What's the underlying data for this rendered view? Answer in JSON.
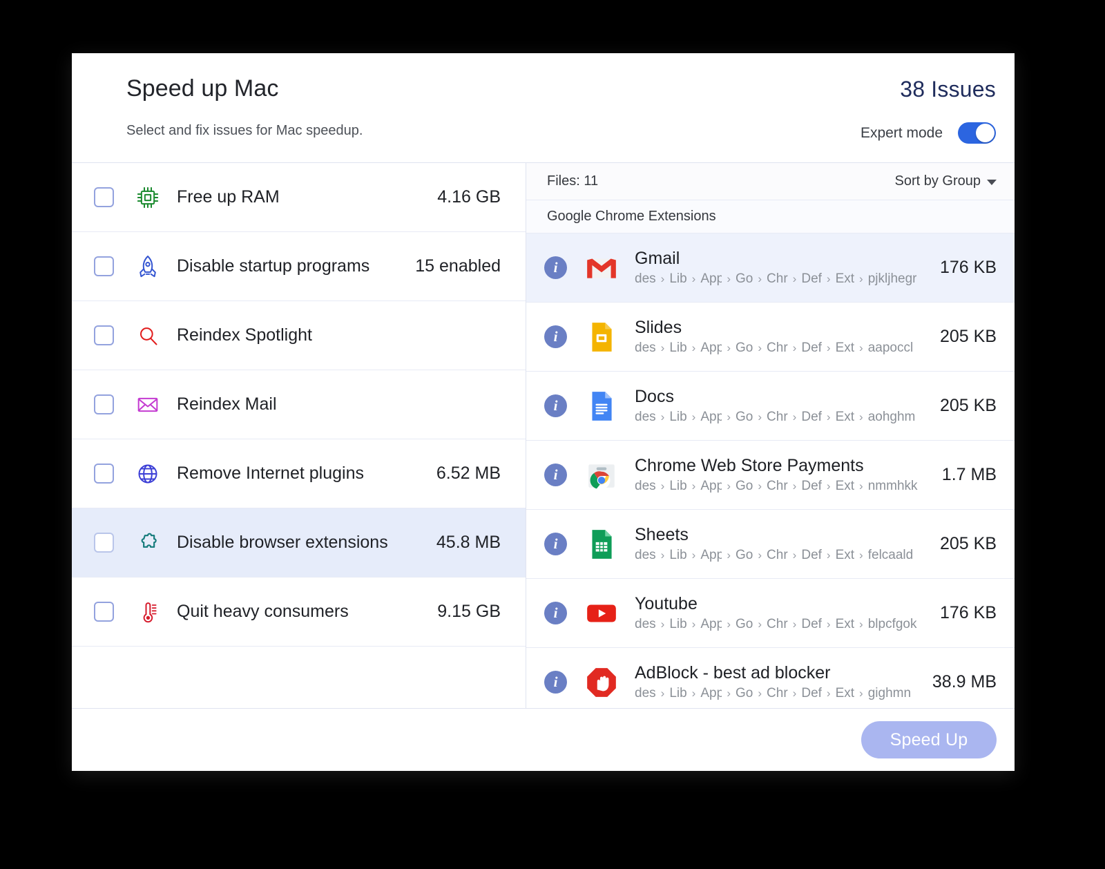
{
  "header": {
    "title": "Speed up Mac",
    "subtitle": "Select and fix issues for Mac speedup.",
    "issues": "38 Issues",
    "expert_mode_label": "Expert mode",
    "expert_mode_on": true,
    "accent_color": "#2c65e0",
    "issues_color": "#1f2c5c"
  },
  "tasks": [
    {
      "label": "Free up RAM",
      "value": "4.16 GB",
      "icon": "cpu-chip-icon",
      "color": "#1a8a2e",
      "selected": false
    },
    {
      "label": "Disable startup programs",
      "value": "15 enabled",
      "icon": "rocket-icon",
      "color": "#3455d1",
      "selected": false
    },
    {
      "label": "Reindex Spotlight",
      "value": "",
      "icon": "magnifier-icon",
      "color": "#e11c1c",
      "selected": false
    },
    {
      "label": "Reindex Mail",
      "value": "",
      "icon": "envelope-icon",
      "color": "#c43bd1",
      "selected": false
    },
    {
      "label": "Remove Internet plugins",
      "value": "6.52 MB",
      "icon": "globe-icon",
      "color": "#3c3fd6",
      "selected": false
    },
    {
      "label": "Disable browser extensions",
      "value": "45.8 MB",
      "icon": "puzzle-piece-icon",
      "color": "#137a7a",
      "selected": true
    },
    {
      "label": "Quit heavy consumers",
      "value": "9.15 GB",
      "icon": "thermometer-icon",
      "color": "#d61a2b",
      "selected": false
    }
  ],
  "detail": {
    "files_count_label": "Files: 11",
    "sort_label": "Sort by Group",
    "group_label": "Google Chrome Extensions",
    "path_segments": [
      "des",
      "Lib",
      "App",
      "Go",
      "Chr",
      "Def",
      "Ext"
    ],
    "files": [
      {
        "name": "Gmail",
        "size": "176 KB",
        "id": "pjkljhegr",
        "icon": "gmail-icon",
        "highlight": true
      },
      {
        "name": "Slides",
        "size": "205 KB",
        "id": "aapoccl",
        "icon": "google-slides-icon",
        "highlight": false
      },
      {
        "name": "Docs",
        "size": "205 KB",
        "id": "aohghm",
        "icon": "google-docs-icon",
        "highlight": false
      },
      {
        "name": "Chrome Web Store Payments",
        "size": "1.7 MB",
        "id": "nmmhkk",
        "icon": "chrome-webstore-icon",
        "highlight": false
      },
      {
        "name": "Sheets",
        "size": "205 KB",
        "id": "felcaald",
        "icon": "google-sheets-icon",
        "highlight": false
      },
      {
        "name": "Youtube",
        "size": "176 KB",
        "id": "blpcfgok",
        "icon": "youtube-icon",
        "highlight": false
      },
      {
        "name": "AdBlock - best ad blocker",
        "size": "38.9 MB",
        "id": "gighmn",
        "icon": "adblock-icon",
        "highlight": false
      }
    ]
  },
  "footer": {
    "speed_up_label": "Speed Up",
    "speed_up_color": "#aab6f0"
  }
}
